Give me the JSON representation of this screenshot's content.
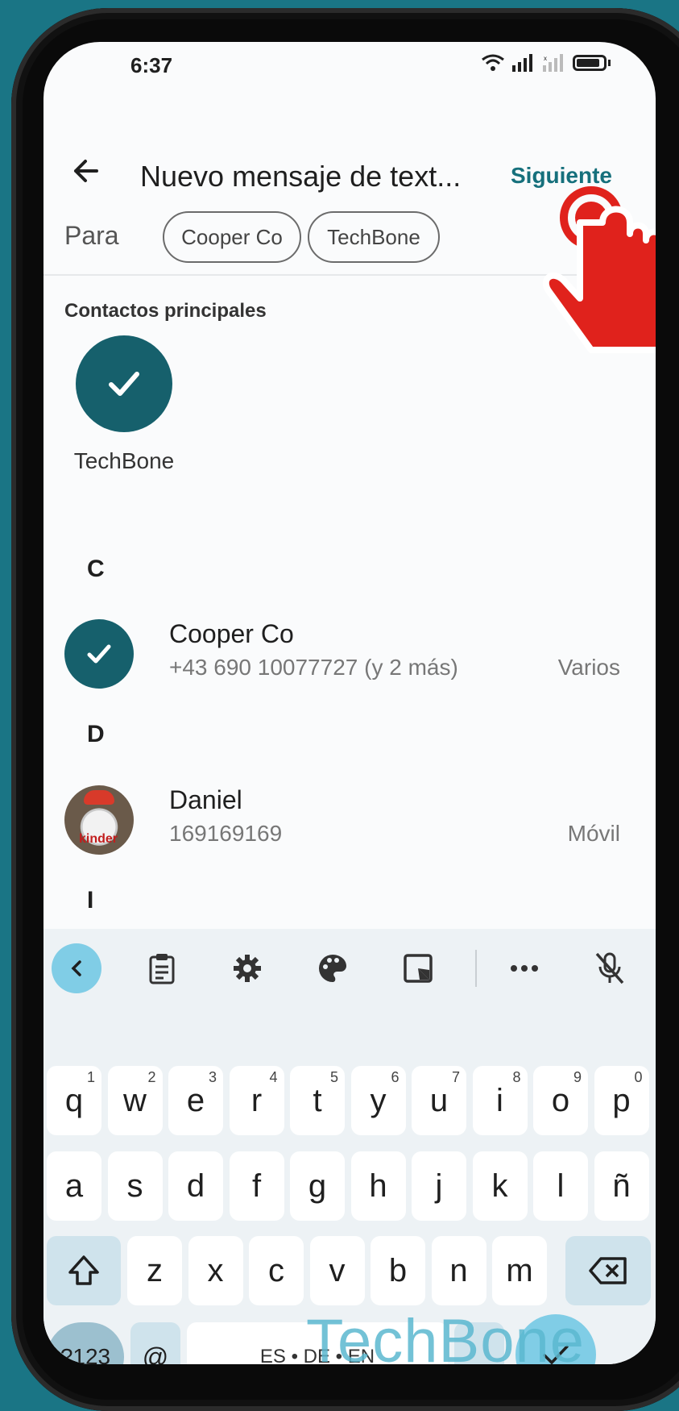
{
  "status_bar": {
    "time": "6:37"
  },
  "header": {
    "title": "Nuevo mensaje de text...",
    "next_label": "Siguiente"
  },
  "recipients": {
    "to_label": "Para",
    "chips": [
      "Cooper Co",
      "TechBone"
    ]
  },
  "top_contacts": {
    "section_label": "Contactos principales",
    "items": [
      {
        "name": "TechBone",
        "selected": true
      }
    ]
  },
  "contacts": {
    "groups": [
      {
        "letter": "C",
        "items": [
          {
            "name": "Cooper Co",
            "number": "+43 690 10077727 (y 2 más)",
            "type": "Varios",
            "selected": true
          }
        ]
      },
      {
        "letter": "D",
        "items": [
          {
            "name": "Daniel",
            "number": "169169169",
            "type": "Móvil",
            "selected": false,
            "avatar_text": "kinder"
          }
        ]
      },
      {
        "letter": "I",
        "items": []
      }
    ]
  },
  "keyboard": {
    "row1": [
      {
        "k": "q",
        "h": "1"
      },
      {
        "k": "w",
        "h": "2"
      },
      {
        "k": "e",
        "h": "3"
      },
      {
        "k": "r",
        "h": "4"
      },
      {
        "k": "t",
        "h": "5"
      },
      {
        "k": "y",
        "h": "6"
      },
      {
        "k": "u",
        "h": "7"
      },
      {
        "k": "i",
        "h": "8"
      },
      {
        "k": "o",
        "h": "9"
      },
      {
        "k": "p",
        "h": "0"
      }
    ],
    "row2": [
      "a",
      "s",
      "d",
      "f",
      "g",
      "h",
      "j",
      "k",
      "l",
      "ñ"
    ],
    "row3": [
      "z",
      "x",
      "c",
      "v",
      "b",
      "n",
      "m"
    ],
    "symbols_label": "?123",
    "at_label": "@",
    "space_label": "ES • DE • EN"
  },
  "watermark": "TechBone",
  "colors": {
    "accent": "#16606c",
    "link": "#16707c",
    "keyboard_accent": "#80cde6",
    "background": "#1a7585"
  }
}
